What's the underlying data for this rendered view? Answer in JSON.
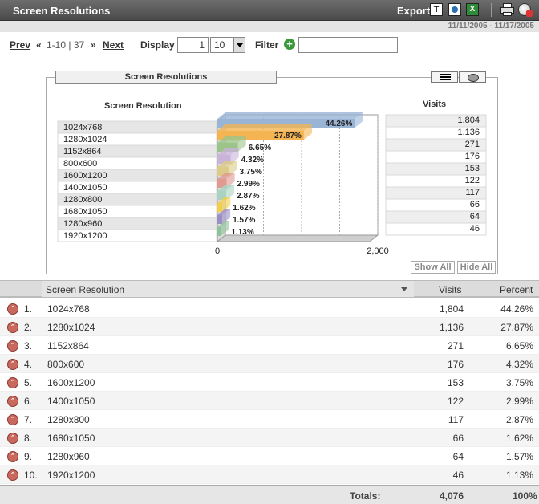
{
  "header": {
    "title": "Screen Resolutions",
    "export_label": "Export"
  },
  "daterange": "11/11/2005 - 11/17/2005",
  "nav": {
    "prev": "Prev",
    "next": "Next",
    "range": "1-10 | 37",
    "display_label": "Display",
    "display_start": "1",
    "display_count": "10",
    "filter_label": "Filter",
    "filter_value": ""
  },
  "chart_data": {
    "type": "bar",
    "title": "Screen Resolutions",
    "category_header": "Screen Resolution",
    "value_header": "Visits",
    "categories": [
      "1024x768",
      "1280x1024",
      "1152x864",
      "800x600",
      "1600x1200",
      "1400x1050",
      "1280x800",
      "1680x1050",
      "1280x960",
      "1920x1200"
    ],
    "values": [
      1804,
      1136,
      271,
      176,
      153,
      122,
      117,
      66,
      64,
      46
    ],
    "value_labels": [
      "1,804",
      "1,136",
      "271",
      "176",
      "153",
      "122",
      "117",
      "66",
      "64",
      "46"
    ],
    "percent_labels": [
      "44.26%",
      "27.87%",
      "6.65%",
      "4.32%",
      "3.75%",
      "2.99%",
      "2.87%",
      "1.62%",
      "1.57%",
      "1.13%"
    ],
    "colors": [
      "#9ab4d6",
      "#f3b451",
      "#9cc48a",
      "#c9b3d8",
      "#dccb88",
      "#e09a90",
      "#a9d3c0",
      "#f2cf4a",
      "#9b8fc4",
      "#8fc19a"
    ],
    "xlim": [
      0,
      2000
    ],
    "xticks": [
      "0",
      "2,000"
    ],
    "grid": true
  },
  "chart_buttons": {
    "show_all": "Show All",
    "hide_all": "Hide All"
  },
  "table": {
    "headers": {
      "name": "Screen Resolution",
      "visits": "Visits",
      "percent": "Percent"
    },
    "rows": [
      {
        "rank": "1.",
        "name": "1024x768",
        "visits": "1,804",
        "percent": "44.26%"
      },
      {
        "rank": "2.",
        "name": "1280x1024",
        "visits": "1,136",
        "percent": "27.87%"
      },
      {
        "rank": "3.",
        "name": "1152x864",
        "visits": "271",
        "percent": "6.65%"
      },
      {
        "rank": "4.",
        "name": "800x600",
        "visits": "176",
        "percent": "4.32%"
      },
      {
        "rank": "5.",
        "name": "1600x1200",
        "visits": "153",
        "percent": "3.75%"
      },
      {
        "rank": "6.",
        "name": "1400x1050",
        "visits": "122",
        "percent": "2.99%"
      },
      {
        "rank": "7.",
        "name": "1280x800",
        "visits": "117",
        "percent": "2.87%"
      },
      {
        "rank": "8.",
        "name": "1680x1050",
        "visits": "66",
        "percent": "1.62%"
      },
      {
        "rank": "9.",
        "name": "1280x960",
        "visits": "64",
        "percent": "1.57%"
      },
      {
        "rank": "10.",
        "name": "1920x1200",
        "visits": "46",
        "percent": "1.13%"
      }
    ],
    "totals": {
      "label": "Totals:",
      "visits": "4,076",
      "percent": "100%"
    }
  }
}
